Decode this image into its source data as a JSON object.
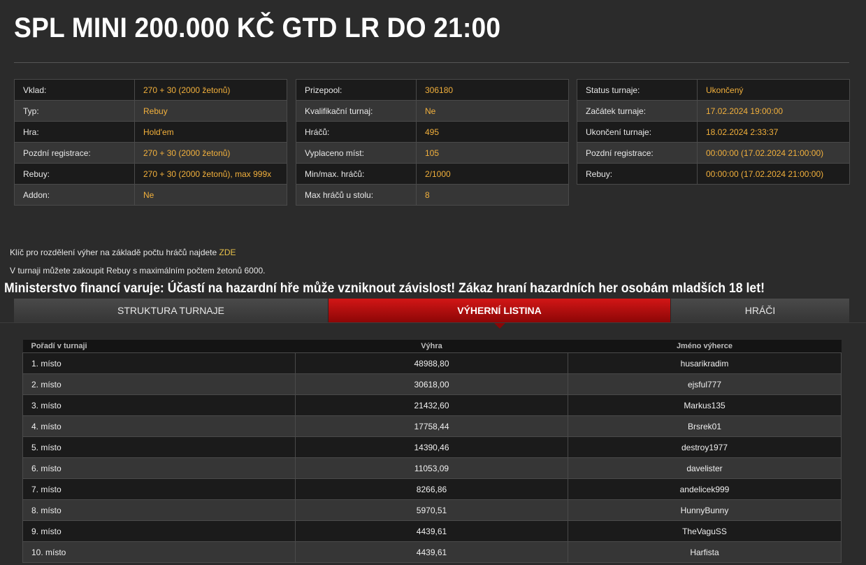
{
  "title": "SPL MINI 200.000 KČ GTD LR DO 21:00",
  "info": {
    "left": [
      {
        "label": "Vklad:",
        "value": "270 + 30 (2000 žetonů)"
      },
      {
        "label": "Typ:",
        "value": "Rebuy"
      },
      {
        "label": "Hra:",
        "value": "Hold'em"
      },
      {
        "label": "Pozdní registrace:",
        "value": "270 + 30 (2000 žetonů)"
      },
      {
        "label": "Rebuy:",
        "value": "270 + 30 (2000 žetonů), max 999x"
      },
      {
        "label": "Addon:",
        "value": "Ne"
      }
    ],
    "middle": [
      {
        "label": "Prizepool:",
        "value": "306180"
      },
      {
        "label": "Kvalifikační turnaj:",
        "value": "Ne"
      },
      {
        "label": "Hráčů:",
        "value": "495"
      },
      {
        "label": "Vyplaceno míst:",
        "value": "105"
      },
      {
        "label": "Min/max. hráčů:",
        "value": "2/1000"
      },
      {
        "label": "Max hráčů u stolu:",
        "value": "8"
      }
    ],
    "right": [
      {
        "label": "Status turnaje:",
        "value": "Ukončený"
      },
      {
        "label": "Začátek turnaje:",
        "value": "17.02.2024 19:00:00"
      },
      {
        "label": "Ukončení turnaje:",
        "value": "18.02.2024 2:33:37"
      },
      {
        "label": "Pozdní registrace:",
        "value": "00:00:00 (17.02.2024 21:00:00)"
      },
      {
        "label": "Rebuy:",
        "value": "00:00:00 (17.02.2024 21:00:00)"
      }
    ]
  },
  "notes": {
    "distribution_text": "Klíč pro rozdělení výher na základě počtu hráčů najdete ",
    "distribution_link": "ZDE",
    "rebuy_text": "V turnaji můžete zakoupit Rebuy s maximálním počtem žetonů 6000."
  },
  "warning": "Ministerstvo financí varuje: Účastí na hazardní hře může vzniknout závislost! Zákaz hraní hazardních her osobám mladších 18 let!",
  "tabs": [
    {
      "label": "STRUKTURA TURNAJE",
      "active": false
    },
    {
      "label": "VÝHERNÍ LISTINA",
      "active": true
    },
    {
      "label": "HRÁČI",
      "active": false
    }
  ],
  "results": {
    "headers": [
      "Pořadí v turnaji",
      "Výhra",
      "Jméno výherce"
    ],
    "rows": [
      [
        "1. místo",
        "48988,80",
        "husarikradim"
      ],
      [
        "2. místo",
        "30618,00",
        "ejsful777"
      ],
      [
        "3. místo",
        "21432,60",
        "Markus135"
      ],
      [
        "4. místo",
        "17758,44",
        "Brsrek01"
      ],
      [
        "5. místo",
        "14390,46",
        "destroy1977"
      ],
      [
        "6. místo",
        "11053,09",
        "davelister"
      ],
      [
        "7. místo",
        "8266,86",
        "andelicek999"
      ],
      [
        "8. místo",
        "5970,51",
        "HunnyBunny"
      ],
      [
        "9. místo",
        "4439,61",
        "TheVaguSS"
      ],
      [
        "10. místo",
        "4439,61",
        "Harfista"
      ]
    ]
  },
  "colors": {
    "background": "#2b2b2b",
    "value_accent": "#f2b03c",
    "active_tab": "#c10d0d"
  }
}
